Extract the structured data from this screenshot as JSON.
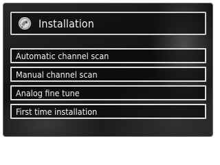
{
  "header": {
    "title": "Installation",
    "icon": "satellite-dish-icon"
  },
  "menu": {
    "items": [
      {
        "label": "Automatic channel scan"
      },
      {
        "label": "Manual channel scan"
      },
      {
        "label": "Analog fine tune"
      },
      {
        "label": "First time installation"
      }
    ]
  },
  "colors": {
    "panel_background": "#1c1c1c",
    "border": "#dedede",
    "text": "#f4f4f4"
  }
}
